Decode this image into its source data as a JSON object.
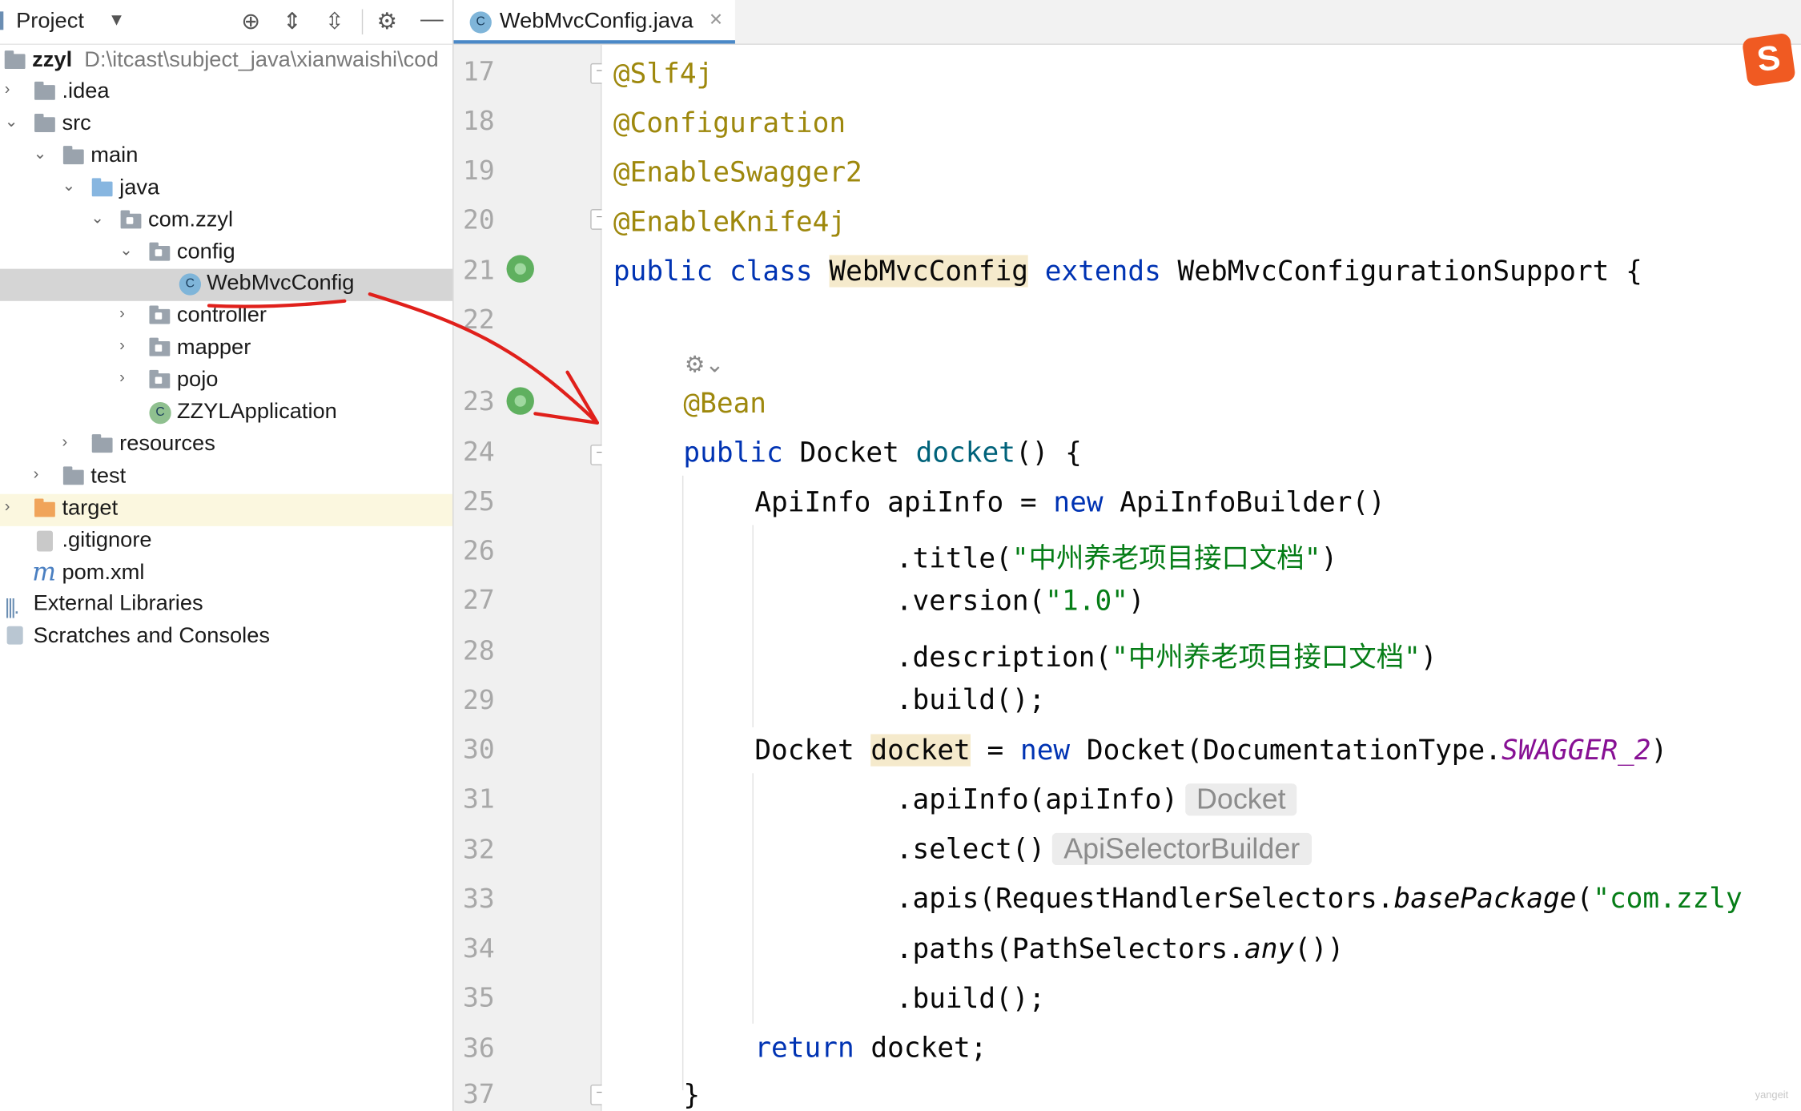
{
  "project_panel": {
    "title": "Project",
    "root": {
      "name": "zzyl",
      "path": "D:\\itcast\\subject_java\\xianwaishi\\cod"
    },
    "items": [
      {
        "label": ".idea"
      },
      {
        "label": "src"
      },
      {
        "label": "main"
      },
      {
        "label": "java"
      },
      {
        "label": "com.zzyl"
      },
      {
        "label": "config"
      },
      {
        "label": "WebMvcConfig"
      },
      {
        "label": "controller"
      },
      {
        "label": "mapper"
      },
      {
        "label": "pojo"
      },
      {
        "label": "ZZYLApplication"
      },
      {
        "label": "resources"
      },
      {
        "label": "test"
      },
      {
        "label": "target"
      },
      {
        "label": ".gitignore"
      },
      {
        "label": "pom.xml"
      },
      {
        "label": "External Libraries"
      },
      {
        "label": "Scratches and Consoles"
      }
    ]
  },
  "editor": {
    "tab_label": "WebMvcConfig.java",
    "line_numbers": [
      "17",
      "18",
      "19",
      "20",
      "21",
      "22",
      "23",
      "24",
      "25",
      "26",
      "27",
      "28",
      "29",
      "30",
      "31",
      "32",
      "33",
      "34",
      "35",
      "36",
      "37"
    ],
    "code": {
      "l17": "@Slf4j",
      "l18": "@Configuration",
      "l19": "@EnableSwagger2",
      "l20": "@EnableKnife4j",
      "l21_kw": "public class ",
      "l21_cls": "WebMvcConfig",
      "l21_ext": " extends ",
      "l21_rest": "WebMvcConfigurationSupport {",
      "l23": "@Bean",
      "l24_kw": "public ",
      "l24_type": "Docket ",
      "l24_fn": "docket",
      "l24_rest": "() {",
      "l25_a": "ApiInfo apiInfo = ",
      "l25_kw": "new ",
      "l25_b": "ApiInfoBuilder()",
      "l26_a": ".title(",
      "l26_str": "\"中州养老项目接口文档\"",
      "l26_b": ")",
      "l27_a": ".version(",
      "l27_str": "\"1.0\"",
      "l27_b": ")",
      "l28_a": ".description(",
      "l28_str": "\"中州养老项目接口文档\"",
      "l28_b": ")",
      "l29": ".build();",
      "l30_a": "Docket ",
      "l30_var": "docket",
      "l30_b": " = ",
      "l30_kw": "new ",
      "l30_c": "Docket(DocumentationType.",
      "l30_const": "SWAGGER_2",
      "l30_d": ")",
      "l31_a": ".apiInfo(apiInfo)",
      "l31_hint": "Docket",
      "l32_a": ".select()",
      "l32_hint": "ApiSelectorBuilder",
      "l33_a": ".apis(RequestHandlerSelectors.",
      "l33_it": "basePackage",
      "l33_b": "(",
      "l33_str": "\"com.zzly",
      "l34_a": ".paths(PathSelectors.",
      "l34_it": "any",
      "l34_b": "())",
      "l35": ".build();",
      "l36_kw": "return ",
      "l36_b": "docket;",
      "l37": "}"
    }
  },
  "colors": {
    "annotation": "#9e880d",
    "keyword": "#0033b3",
    "string": "#067d17",
    "highlight": "#f5eacc",
    "red_annotation": "#e0201b"
  },
  "overlay": {
    "logo_letter": "S",
    "watermark": "yangeit"
  }
}
